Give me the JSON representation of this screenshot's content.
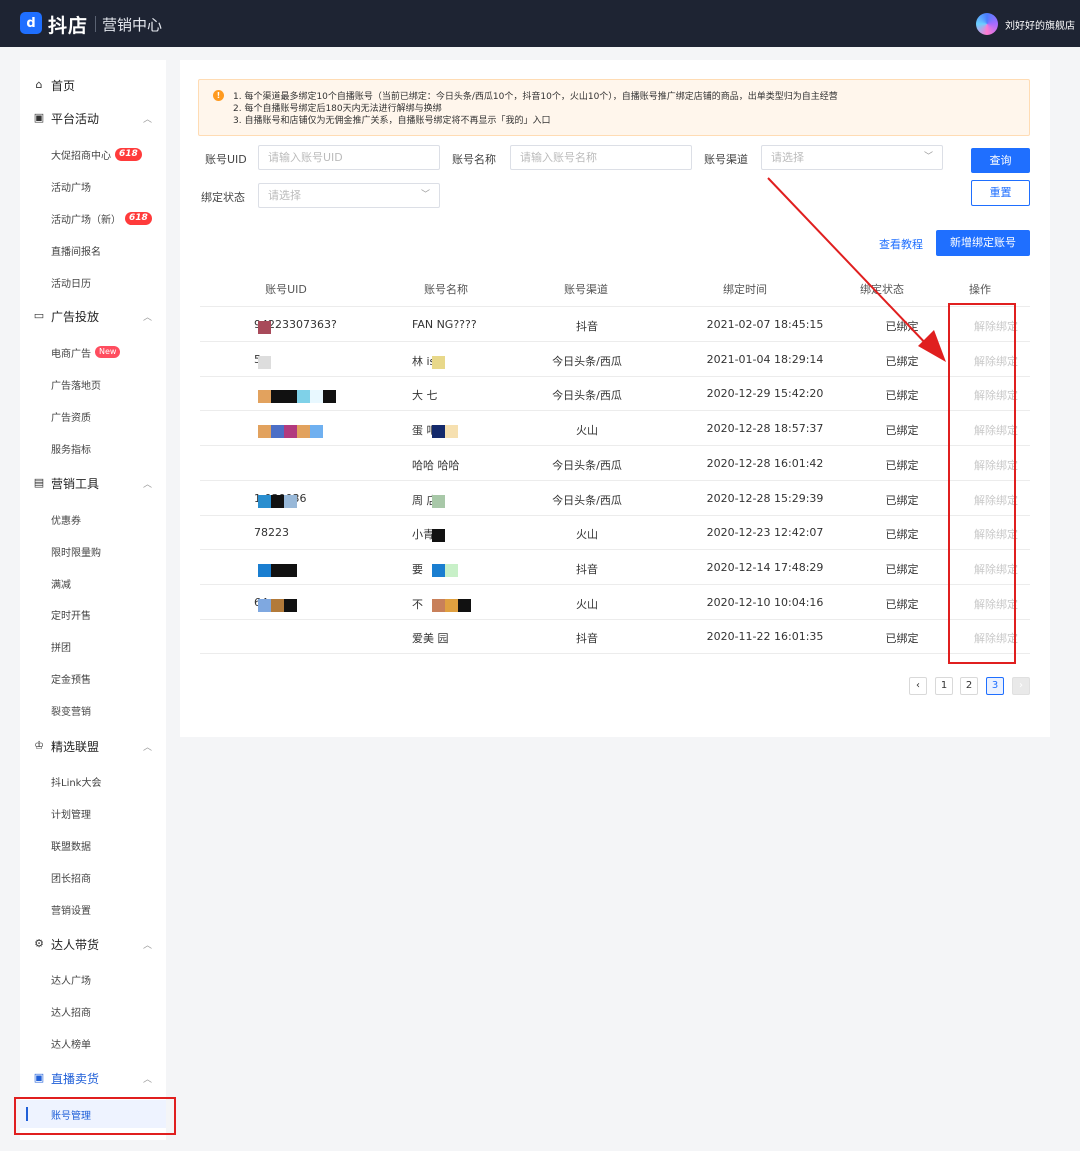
{
  "header": {
    "logo_glyph": "d",
    "brand": "抖店",
    "subtitle": "营销中心",
    "shop_name": "刘好好的旗舰店"
  },
  "sidebar": {
    "home": "首页",
    "groups": [
      {
        "label": "平台活动",
        "items": [
          {
            "label": "大促招商中心",
            "badge": "618"
          },
          {
            "label": "活动广场"
          },
          {
            "label": "活动广场（新）",
            "badge": "618"
          },
          {
            "label": "直播间报名"
          },
          {
            "label": "活动日历"
          }
        ]
      },
      {
        "label": "广告投放",
        "items": [
          {
            "label": "电商广告",
            "badge": "New"
          },
          {
            "label": "广告落地页"
          },
          {
            "label": "广告资质"
          },
          {
            "label": "服务指标"
          }
        ]
      },
      {
        "label": "营销工具",
        "items": [
          {
            "label": "优惠券"
          },
          {
            "label": "限时限量购"
          },
          {
            "label": "满减"
          },
          {
            "label": "定时开售"
          },
          {
            "label": "拼团"
          },
          {
            "label": "定金预售"
          },
          {
            "label": "裂变营销"
          }
        ]
      },
      {
        "label": "精选联盟",
        "items": [
          {
            "label": "抖Link大会"
          },
          {
            "label": "计划管理"
          },
          {
            "label": "联盟数据"
          },
          {
            "label": "团长招商"
          },
          {
            "label": "营销设置"
          }
        ]
      },
      {
        "label": "达人带货",
        "items": [
          {
            "label": "达人广场"
          },
          {
            "label": "达人招商"
          },
          {
            "label": "达人榜单"
          }
        ]
      },
      {
        "label": "直播卖货",
        "items": [
          {
            "label": "账号管理",
            "active": true
          }
        ]
      }
    ]
  },
  "notice": {
    "lines": [
      "1. 每个渠道最多绑定10个自播账号（当前已绑定：今日头条/西瓜10个，抖音10个，火山10个），自播账号推广绑定店铺的商品，出单类型归为自主经营",
      "2. 每个自播账号绑定后180天内无法进行解绑与换绑",
      "3. 自播账号和店铺仅为无佣金推广关系，自播账号绑定将不再显示「我的」入口"
    ]
  },
  "filters": {
    "uid_label": "账号UID",
    "uid_placeholder": "请输入账号UID",
    "name_label": "账号名称",
    "name_placeholder": "请输入账号名称",
    "channel_label": "账号渠道",
    "channel_placeholder": "请选择",
    "status_label": "绑定状态",
    "status_placeholder": "请选择",
    "query_button": "查询",
    "reset_button": "重置"
  },
  "actions": {
    "tutorial_link": "查看教程",
    "add_button": "新增绑定账号"
  },
  "table": {
    "headers": [
      "账号UID",
      "账号名称",
      "账号渠道",
      "绑定时间",
      "绑定状态",
      "操作"
    ],
    "rows": [
      {
        "uid": "94223307363?",
        "name": "FAN NG????",
        "channel": "抖音",
        "time": "2021-02-07 18:45:15",
        "status": "已绑定",
        "op": "解除绑定"
      },
      {
        "uid": "5",
        "name": "林 ise",
        "channel": "今日头条/西瓜",
        "time": "2021-01-04 18:29:14",
        "status": "已绑定",
        "op": "解除绑定"
      },
      {
        "uid": "",
        "name": "大 七",
        "channel": "今日头条/西瓜",
        "time": "2020-12-29 15:42:20",
        "status": "已绑定",
        "op": "解除绑定"
      },
      {
        "uid": "",
        "name": "蛋 吧",
        "channel": "火山",
        "time": "2020-12-28 18:57:37",
        "status": "已绑定",
        "op": "解除绑定"
      },
      {
        "uid": "",
        "name": "哈哈 哈哈",
        "channel": "今日头条/西瓜",
        "time": "2020-12-28 16:01:42",
        "status": "已绑定",
        "op": "解除绑定"
      },
      {
        "uid": "1 030036",
        "name": "周 店",
        "channel": "今日头条/西瓜",
        "time": "2020-12-28 15:29:39",
        "status": "已绑定",
        "op": "解除绑定"
      },
      {
        "uid": "78223",
        "name": "小青",
        "channel": "火山",
        "time": "2020-12-23 12:42:07",
        "status": "已绑定",
        "op": "解除绑定"
      },
      {
        "uid": "",
        "name": "要",
        "channel": "抖音",
        "time": "2020-12-14 17:48:29",
        "status": "已绑定",
        "op": "解除绑定"
      },
      {
        "uid": "64",
        "name": "不",
        "channel": "火山",
        "time": "2020-12-10 10:04:16",
        "status": "已绑定",
        "op": "解除绑定"
      },
      {
        "uid": "",
        "name": "爱美 园",
        "channel": "抖音",
        "time": "2020-11-22 16:01:35",
        "status": "已绑定",
        "op": "解除绑定"
      }
    ]
  },
  "pagination": {
    "prev": "‹",
    "pages": [
      "1",
      "2",
      "3"
    ],
    "current": "3",
    "next": "›"
  },
  "colors": {
    "topbar": "#1e2433",
    "primary": "#1f6fff",
    "annotation_red": "#e01f1f"
  }
}
